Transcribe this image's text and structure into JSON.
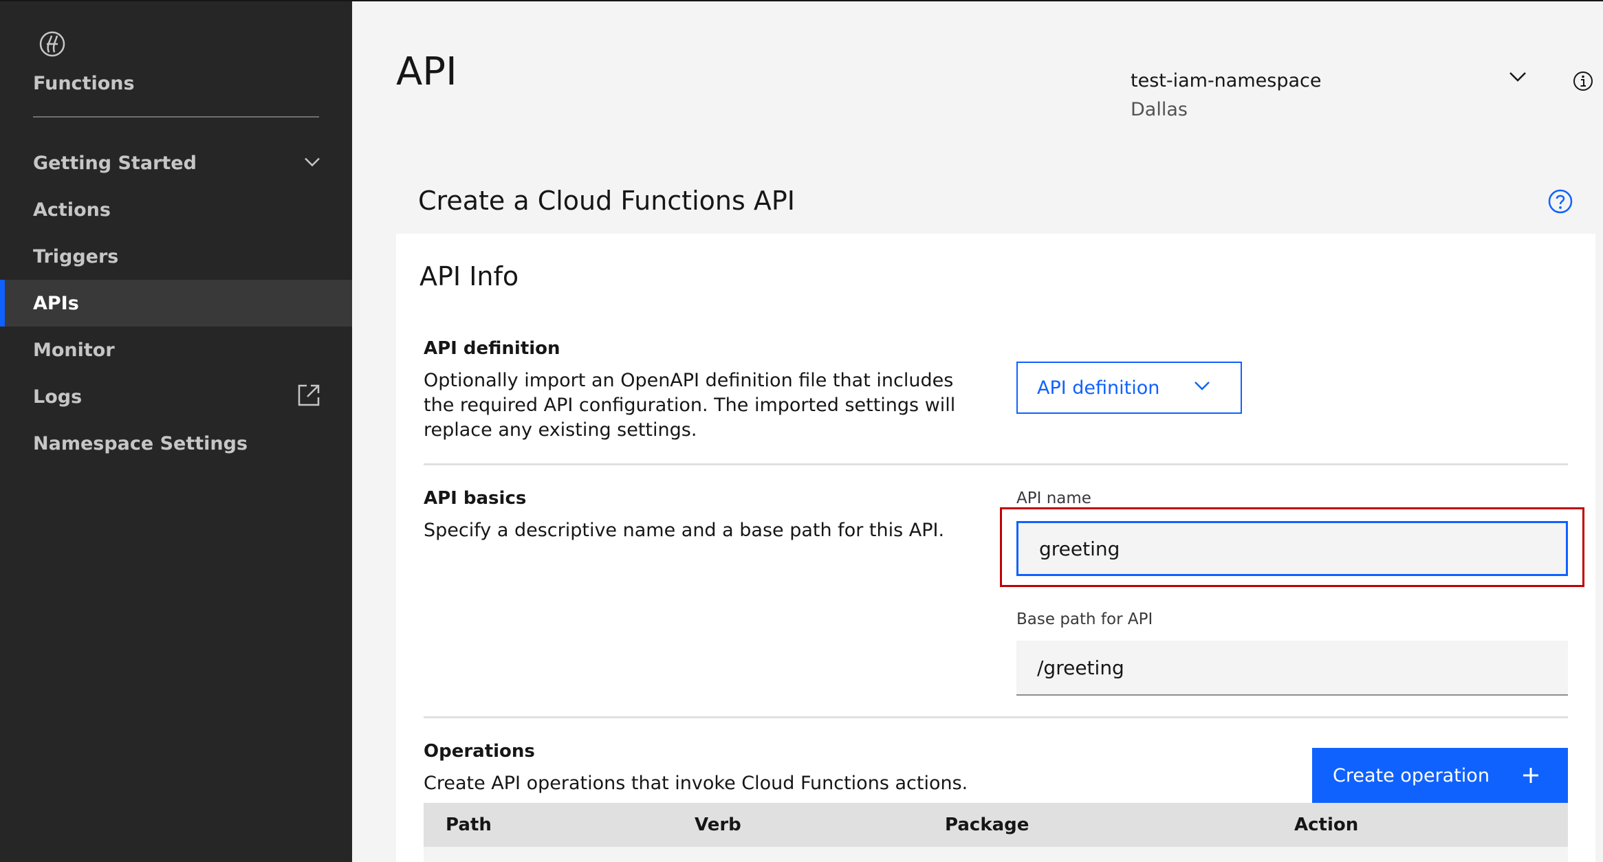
{
  "sidebar": {
    "app_title": "Functions",
    "logo_icon": "cloud-functions-logo-icon",
    "items": [
      {
        "label": "Getting Started",
        "icon": "chevron-down-icon",
        "active": false
      },
      {
        "label": "Actions",
        "active": false
      },
      {
        "label": "Triggers",
        "active": false
      },
      {
        "label": "APIs",
        "active": true
      },
      {
        "label": "Monitor",
        "active": false
      },
      {
        "label": "Logs",
        "icon": "launch-external-icon",
        "active": false
      },
      {
        "label": "Namespace Settings",
        "active": false
      }
    ]
  },
  "header": {
    "title": "API",
    "namespace": "test-iam-namespace",
    "region": "Dallas"
  },
  "section_title": "Create a Cloud Functions API",
  "card": {
    "title": "API Info",
    "api_definition": {
      "heading": "API definition",
      "description": "Optionally import an OpenAPI definition file that includes the required API configuration. The imported settings will replace any existing settings.",
      "dropdown_label": "API definition"
    },
    "api_basics": {
      "heading": "API basics",
      "description": "Specify a descriptive name and a base path for this API.",
      "name_label": "API name",
      "name_value": "greeting",
      "base_path_label": "Base path for API",
      "base_path_value": "/greeting"
    },
    "operations": {
      "heading": "Operations",
      "description": "Create API operations that invoke Cloud Functions actions.",
      "create_button": "Create operation",
      "columns": [
        "Path",
        "Verb",
        "Package",
        "Action"
      ]
    }
  },
  "colors": {
    "accent": "#0f62fe",
    "sidebar_bg": "#262626",
    "highlight": "#c00000"
  }
}
